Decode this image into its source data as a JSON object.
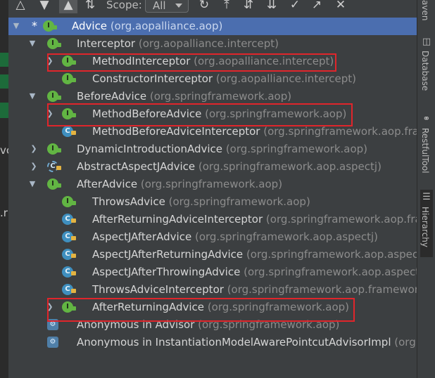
{
  "toolbar": {
    "scope_label": "Scope:",
    "scope_value": "All"
  },
  "tree": [
    {
      "name": "Advice",
      "pkg": "(org.aopalliance.aop)",
      "kind": "i"
    },
    {
      "name": "Interceptor",
      "pkg": "(org.aopalliance.intercept)",
      "kind": "i"
    },
    {
      "name": "MethodInterceptor",
      "pkg": "(org.aopalliance.intercept)",
      "kind": "i"
    },
    {
      "name": "ConstructorInterceptor",
      "pkg": "(org.aopalliance.intercept)",
      "kind": "i"
    },
    {
      "name": "BeforeAdvice",
      "pkg": "(org.springframework.aop)",
      "kind": "i"
    },
    {
      "name": "MethodBeforeAdvice",
      "pkg": "(org.springframework.aop)",
      "kind": "i"
    },
    {
      "name": "MethodBeforeAdviceInterceptor",
      "pkg": "(org.springframework.aop.fram",
      "kind": "c"
    },
    {
      "name": "DynamicIntroductionAdvice",
      "pkg": "(org.springframework.aop)",
      "kind": "i"
    },
    {
      "name": "AbstractAspectJAdvice",
      "pkg": "(org.springframework.aop.aspectj)",
      "kind": "cabs"
    },
    {
      "name": "AfterAdvice",
      "pkg": "(org.springframework.aop)",
      "kind": "i"
    },
    {
      "name": "ThrowsAdvice",
      "pkg": "(org.springframework.aop)",
      "kind": "i"
    },
    {
      "name": "AfterReturningAdviceInterceptor",
      "pkg": "(org.springframework.aop.fram",
      "kind": "c"
    },
    {
      "name": "AspectJAfterAdvice",
      "pkg": "(org.springframework.aop.aspectj)",
      "kind": "c"
    },
    {
      "name": "AspectJAfterReturningAdvice",
      "pkg": "(org.springframework.aop.aspect",
      "kind": "c"
    },
    {
      "name": "AspectJAfterThrowingAdvice",
      "pkg": "(org.springframework.aop.aspectj",
      "kind": "c"
    },
    {
      "name": "ThrowsAdviceInterceptor",
      "pkg": "(org.springframework.aop.framework",
      "kind": "c"
    },
    {
      "name": "AfterReturningAdvice",
      "pkg": "(org.springframework.aop)",
      "kind": "i"
    },
    {
      "name": "Anonymous in Advisor",
      "pkg": "(org.springframework.aop)",
      "kind": "anon"
    },
    {
      "name": "Anonymous in InstantiationModelAwarePointcutAdvisorImpl",
      "pkg": "(org.s",
      "kind": "anon"
    }
  ],
  "right_tabs": [
    "aven",
    "Database",
    "RestfulTool",
    "Hierarchy"
  ],
  "left_strip_chars": [
    "vc",
    ".r"
  ]
}
